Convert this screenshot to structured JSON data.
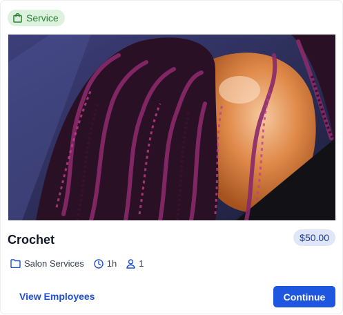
{
  "badge": {
    "label": "Service",
    "icon": "shopping-bag-icon",
    "color": "#2e7d32"
  },
  "service": {
    "name": "Crochet",
    "price": "$50.00",
    "category": "Salon Services",
    "duration": "1h",
    "capacity": "1"
  },
  "photo": {
    "subject": "crochet-braids-photo"
  },
  "actions": {
    "view_employees_label": "View Employees",
    "continue_label": "Continue"
  },
  "colors": {
    "accent": "#1f56e0",
    "price_bg": "#e1e7fb",
    "badge_bg": "#dcf2df"
  }
}
